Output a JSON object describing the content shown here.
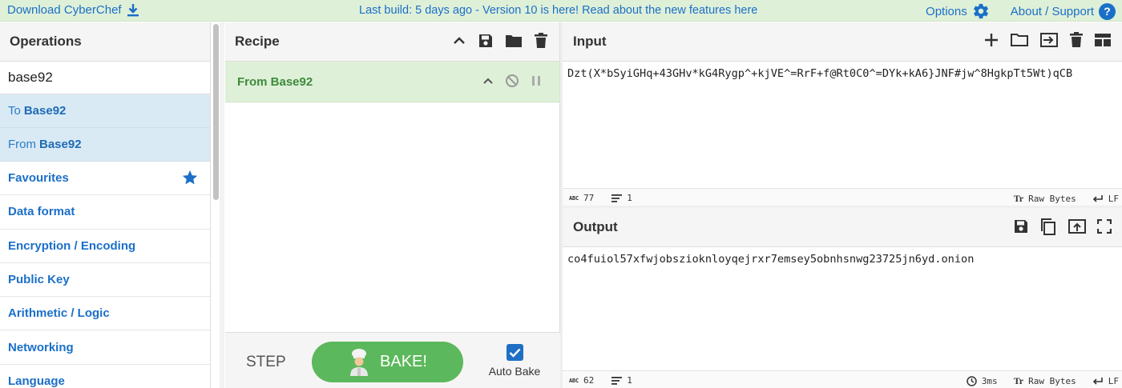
{
  "banner": {
    "download_label": "Download CyberChef",
    "build_message": "Last build: 5 days ago - Version 10 is here! Read about the new features here",
    "options_label": "Options",
    "about_label": "About / Support",
    "help_glyph": "?"
  },
  "operations": {
    "title": "Operations",
    "search_value": "base92",
    "results": [
      {
        "prefix": "To",
        "name": "Base92"
      },
      {
        "prefix": "From",
        "name": "Base92"
      }
    ],
    "categories": [
      "Favourites",
      "Data format",
      "Encryption / Encoding",
      "Public Key",
      "Arithmetic / Logic",
      "Networking",
      "Language"
    ]
  },
  "recipe": {
    "title": "Recipe",
    "operation": "From Base92",
    "step_label": "STEP",
    "bake_label": "BAKE!",
    "auto_bake_label": "Auto Bake",
    "auto_bake_checked": true
  },
  "input": {
    "title": "Input",
    "text": "Dzt(X*bSyiGHq+43GHv*kG4Rygp^+kjVE^=RrF+f@Rt0C0^=DYk+kA6}JNF#jw^8HgkpTt5Wt)qCB",
    "char_count": "77",
    "line_count": "1",
    "encoding": "Raw Bytes",
    "eol": "LF"
  },
  "output": {
    "title": "Output",
    "text": "co4fuiol57xfwjobszioknloyqejrxr7emsey5obnhsnwg23725jn6yd.onion",
    "char_count": "62",
    "line_count": "1",
    "time": "3ms",
    "encoding": "Raw Bytes",
    "eol": "LF"
  },
  "colors": {
    "banner_bg": "#dff0d8",
    "link_blue": "#1b6fc8",
    "selected_bg": "#d9eaf5",
    "recipe_op_bg": "#dff0d8",
    "bake_green": "#5cb85c"
  }
}
